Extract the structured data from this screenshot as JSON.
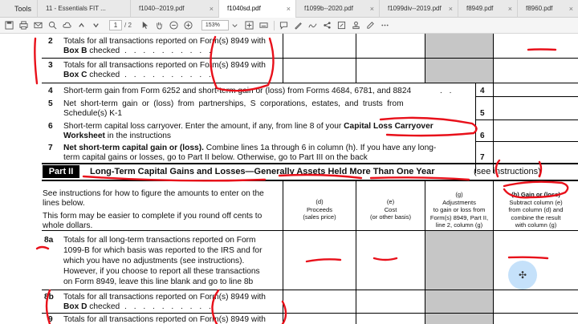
{
  "app": {
    "tools_label": "Tools",
    "tabs": [
      {
        "label": "11 - Essentials FIT ...",
        "active": false
      },
      {
        "label": "f1040--2019.pdf",
        "active": false
      },
      {
        "label": "f1040sd.pdf",
        "active": true
      },
      {
        "label": "f1099b--2020.pdf",
        "active": false
      },
      {
        "label": "f1099div--2019.pdf",
        "active": false
      },
      {
        "label": "f8949.pdf",
        "active": false
      },
      {
        "label": "f8960.pdf",
        "active": false
      }
    ],
    "tab_close": "×"
  },
  "toolbar": {
    "page_current": "1",
    "page_total": "/ 2",
    "zoom": "153%",
    "icons": [
      "save-icon",
      "print-icon",
      "mail-icon",
      "search-icon",
      "cloud-icon",
      "prev-page-icon",
      "next-page-icon",
      "cursor-icon",
      "hand-icon",
      "zoom-out-icon",
      "zoom-in-icon",
      "chevron-down-icon",
      "fit-page-icon",
      "keyboard-icon",
      "comment-icon",
      "highlight-icon",
      "sign-icon",
      "share-icon",
      "edit-icon",
      "stamp-icon",
      "markup-icon",
      "more-icon"
    ]
  },
  "form": {
    "line2": {
      "num": "2",
      "text_a": "Totals for all transactions reported on Form(s) 8949 with",
      "text_b": "Box B",
      "text_c": " checked"
    },
    "line3": {
      "num": "3",
      "text_a": "Totals for all transactions reported on Form(s) 8949 with",
      "text_b": "Box C",
      "text_c": " checked"
    },
    "line4": {
      "num": "4",
      "text": "Short-term gain from Form 6252 and short-term gain or (loss) from Forms 4684, 6781, and 8824",
      "box": "4"
    },
    "line5": {
      "num": "5",
      "text_a": "Net short-term gain or (loss) from partnerships, S corporations, estates, and trusts from",
      "text_b": "Schedule(s) K-1",
      "box": "5"
    },
    "line6": {
      "num": "6",
      "text_a": "Short-term capital loss carryover. Enter the amount, if any, from line 8 of your ",
      "text_a_bold": "Capital Loss Carryover",
      "text_b_bold": "Worksheet",
      "text_b": " in the instructions",
      "box": "6"
    },
    "line7": {
      "num": "7",
      "text_a_bold": "Net short-term capital gain or (loss).",
      "text_a": " Combine lines 1a through 6 in column (h). If you have any long-",
      "text_b": "term capital gains or losses, go to Part II below. Otherwise, go to Part III on the back",
      "box": "7"
    },
    "part2": {
      "label": "Part II",
      "title": "Long-Term Capital Gains and Losses—Generally Assets Held More Than One Year",
      "subtitle": "(see instructions)",
      "instructions": [
        "See instructions for how to figure the amounts to enter on the",
        "lines below.",
        "This form may be easier to complete if you round off cents to",
        "whole dollars."
      ],
      "col_d": [
        "(d)",
        "Proceeds",
        "(sales price)"
      ],
      "col_e": [
        "(e)",
        "Cost",
        "(or other basis)"
      ],
      "col_g": [
        "(g)",
        "Adjustments",
        "to gain or loss from",
        "Form(s) 8949, Part II,",
        "line 2, column (g)"
      ],
      "col_h": [
        "(h) Gain or (loss)",
        "Subtract column (e)",
        "from column (d) and",
        "combine the result",
        "with column (g)"
      ]
    },
    "line8a": {
      "num": "8a",
      "lines": [
        "Totals for all long-term transactions reported on Form",
        "1099-B for which basis was reported to the IRS and for",
        "which you have no adjustments (see instructions).",
        "However, if you choose to report all these transactions",
        "on Form 8949, leave this line blank and go to line 8b"
      ]
    },
    "line8b": {
      "num": "8b",
      "text_a": "Totals for all transactions reported on Form(s) 8949 with",
      "text_b": "Box D",
      "text_c": " checked"
    },
    "line9": {
      "num": "9",
      "text_a": "Totals for all transactions reported on Form(s) 8949 with"
    }
  },
  "annotation": {
    "color": "#e8101a"
  }
}
